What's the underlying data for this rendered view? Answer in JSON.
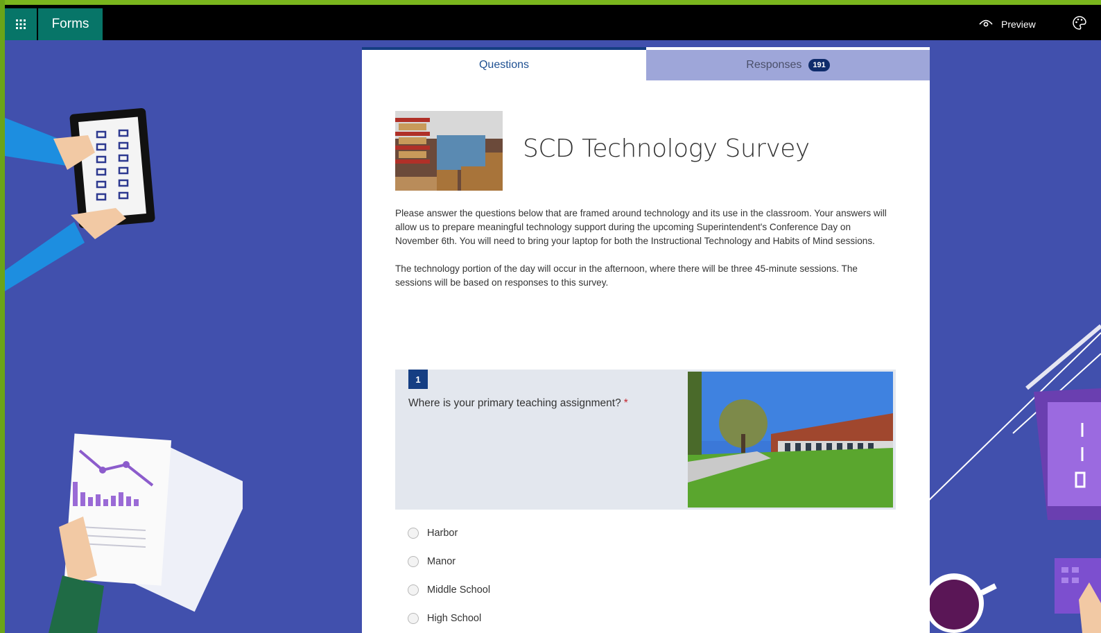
{
  "app": {
    "name": "Forms"
  },
  "toolbar": {
    "preview_label": "Preview"
  },
  "tabs": {
    "questions_label": "Questions",
    "responses_label": "Responses",
    "responses_count": "191"
  },
  "survey": {
    "title": "SCD Technology Survey",
    "description_paragraphs": [
      "Please answer the questions below that are framed around technology and its use in the classroom.  Your answers will allow us to prepare meaningful technology support during the upcoming Superintendent's Conference Day on November 6th.  You will need to bring your laptop for both the Instructional Technology and Habits of Mind sessions.",
      "The technology portion of the day will occur in the afternoon, where there will be three 45-minute sessions.  The sessions will be based on responses to this survey."
    ]
  },
  "question1": {
    "number": "1",
    "text": "Where is your primary teaching assignment?",
    "required_mark": "*",
    "options": [
      "Harbor",
      "Manor",
      "Middle School",
      "High School"
    ]
  },
  "colors": {
    "background": "#4150ad",
    "accent": "#077568",
    "tab_active": "#153e83",
    "required": "#c4262e"
  },
  "icons": {
    "waffle": "app-launcher-icon",
    "preview": "eye-icon",
    "theme": "palette-icon"
  }
}
